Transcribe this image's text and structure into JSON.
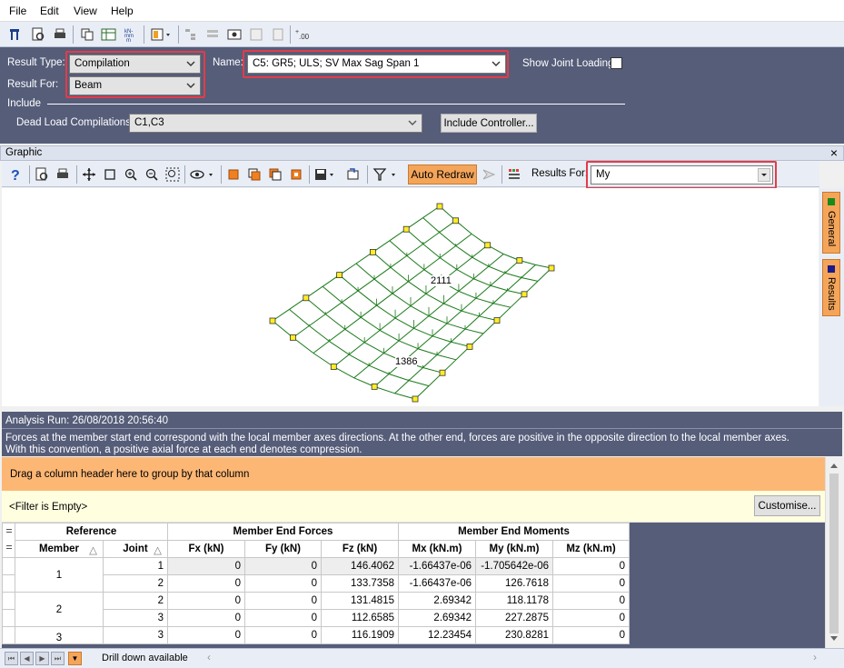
{
  "menu": [
    "File",
    "Edit",
    "View",
    "Help"
  ],
  "params": {
    "result_type_label": "Result Type:",
    "result_type_value": "Compilation",
    "result_for_label": "Result For:",
    "result_for_value": "Beam",
    "name_label": "Name:",
    "name_value": "C5: GR5; ULS; SV Max Sag Span 1",
    "show_joint_loading": "Show Joint Loading",
    "include_label": "Include",
    "dead_load_label": "Dead Load Compilations:",
    "dead_load_value": "C1,C3",
    "include_controller": "Include Controller..."
  },
  "graphic": {
    "panel_title": "Graphic",
    "close_glyph": "×",
    "auto_redraw": "Auto Redraw",
    "results_for_label": "Results For:",
    "results_for_value": "My",
    "label_max": "2111",
    "label_min": "1386",
    "tab_general": "General",
    "tab_results": "Results"
  },
  "info": {
    "analysis_run": "Analysis Run: 26/08/2018 20:56:40",
    "line1": "Forces at the member start end correspond with the local member axes directions. At the other end, forces are positive in the opposite direction to the local member axes.",
    "line2": "With this convention, a positive axial force at each end denotes compression."
  },
  "grid": {
    "group_hint": "Drag a column header here to group by that column",
    "filter_text": "<Filter is Empty>",
    "customise": "Customise...",
    "bands": {
      "reference": "Reference",
      "forces": "Member End Forces",
      "moments": "Member End Moments"
    },
    "columns": [
      "Member",
      "Joint",
      "Fx (kN)",
      "Fy (kN)",
      "Fz (kN)",
      "Mx (kN.m)",
      "My (kN.m)",
      "Mz (kN.m)"
    ],
    "rows": [
      {
        "member": "1",
        "joint": "1",
        "fx": "0",
        "fy": "0",
        "fz": "146.4062",
        "mx": "-1.66437e-06",
        "my": "-1.705642e-06",
        "mz": "0"
      },
      {
        "member": "",
        "joint": "2",
        "fx": "0",
        "fy": "0",
        "fz": "133.7358",
        "mx": "-1.66437e-06",
        "my": "126.7618",
        "mz": "0"
      },
      {
        "member": "2",
        "joint": "2",
        "fx": "0",
        "fy": "0",
        "fz": "131.4815",
        "mx": "2.69342",
        "my": "118.1178",
        "mz": "0"
      },
      {
        "member": "",
        "joint": "3",
        "fx": "0",
        "fy": "0",
        "fz": "112.6585",
        "mx": "2.69342",
        "my": "227.2875",
        "mz": "0"
      },
      {
        "member": "3",
        "joint": "3",
        "fx": "0",
        "fy": "0",
        "fz": "116.1909",
        "mx": "12.23454",
        "my": "230.8281",
        "mz": "0"
      }
    ]
  },
  "status": {
    "drill_down": "Drill down available"
  },
  "colors": {
    "accent": "#e53b47",
    "panel": "#555d79",
    "orange": "#fdb775",
    "mesh": "#1a7a1a"
  }
}
